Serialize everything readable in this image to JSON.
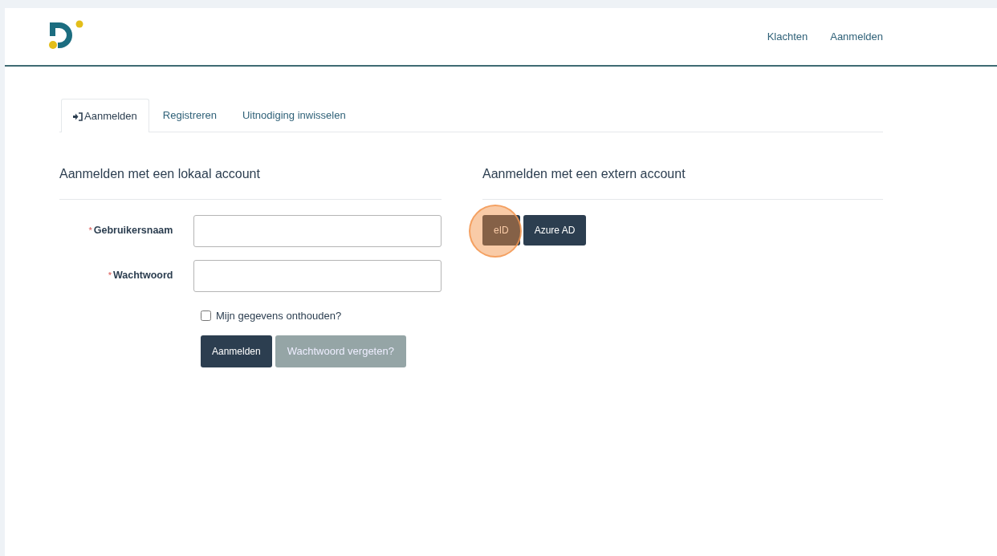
{
  "header": {
    "nav_links": [
      "Klachten",
      "Aanmelden"
    ]
  },
  "tabs": [
    {
      "label": "Aanmelden",
      "selected": true,
      "kind": "icon"
    },
    {
      "label": "Registreren",
      "selected": false,
      "kind": "plain"
    },
    {
      "label": "Uitnodiging inwisselen",
      "selected": false,
      "kind": "plain"
    }
  ],
  "local_account": {
    "title": "Aanmelden met een lokaal account",
    "fields": [
      {
        "label": "Gebruikersnaam",
        "required_mark": "*"
      },
      {
        "label": "Wachtwoord",
        "required_mark": "*"
      }
    ],
    "remember": {
      "label": "Mijn gegevens onthouden?",
      "checked": false
    },
    "buttons": [
      {
        "label": "Aanmelden",
        "kind": "primary"
      },
      {
        "label": "Wachtwoord vergeten?",
        "kind": "muted"
      }
    ]
  },
  "external_account": {
    "title": "Aanmelden met een extern account",
    "buttons": [
      {
        "label": "eID",
        "highlighted": true
      },
      {
        "label": "Azure AD",
        "highlighted": false
      }
    ]
  }
}
